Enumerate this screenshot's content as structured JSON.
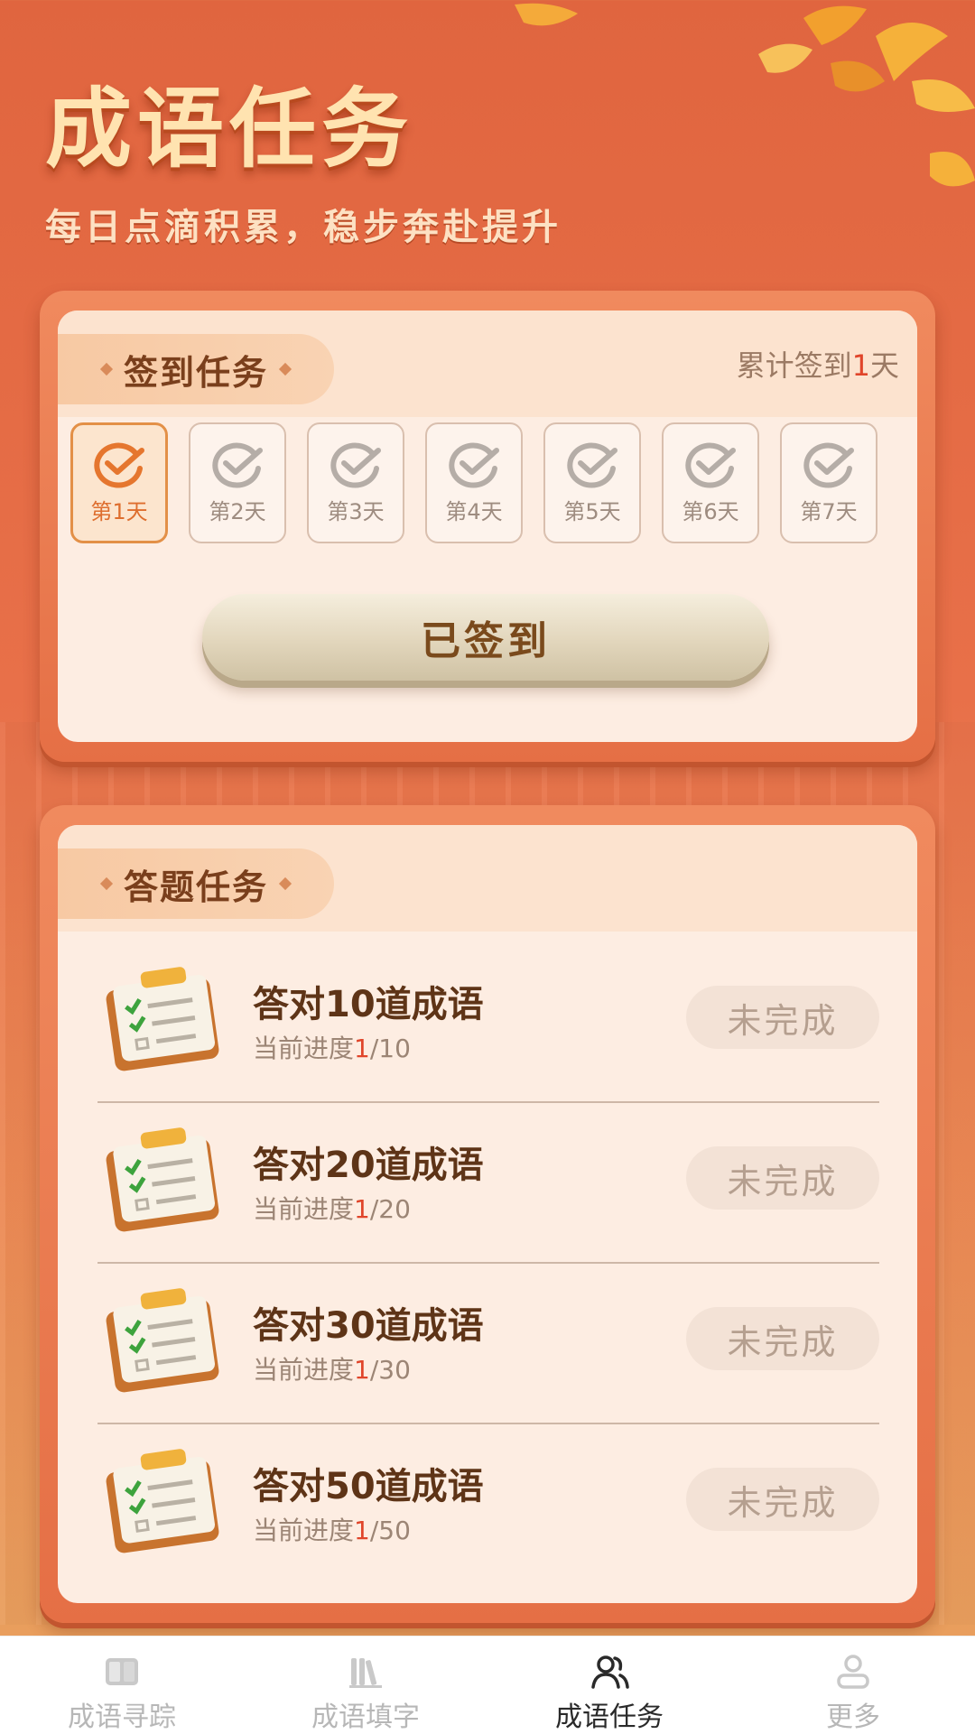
{
  "header": {
    "title": "成语任务",
    "subtitle": "每日点滴积累，稳步奔赴提升"
  },
  "signin": {
    "title": "签到任务",
    "total_prefix": "累计签到",
    "total_days": "1",
    "total_suffix": "天",
    "days": [
      {
        "label": "第1天",
        "checked": true
      },
      {
        "label": "第2天",
        "checked": false
      },
      {
        "label": "第3天",
        "checked": false
      },
      {
        "label": "第4天",
        "checked": false
      },
      {
        "label": "第5天",
        "checked": false
      },
      {
        "label": "第6天",
        "checked": false
      },
      {
        "label": "第7天",
        "checked": false
      }
    ],
    "button_label": "已签到"
  },
  "quiz": {
    "title": "答题任务",
    "progress_prefix": "当前进度",
    "tasks": [
      {
        "title": "答对10道成语",
        "current": "1",
        "total": "/10",
        "status": "未完成"
      },
      {
        "title": "答对20道成语",
        "current": "1",
        "total": "/20",
        "status": "未完成"
      },
      {
        "title": "答对30道成语",
        "current": "1",
        "total": "/30",
        "status": "未完成"
      },
      {
        "title": "答对50道成语",
        "current": "1",
        "total": "/50",
        "status": "未完成"
      }
    ]
  },
  "tabbar": {
    "tabs": [
      {
        "label": "成语寻踪",
        "icon": "book-icon",
        "active": false
      },
      {
        "label": "成语填字",
        "icon": "library-icon",
        "active": false
      },
      {
        "label": "成语任务",
        "icon": "users-icon",
        "active": true
      },
      {
        "label": "更多",
        "icon": "profile-icon",
        "active": false
      }
    ]
  },
  "colors": {
    "background": "#E0653F",
    "accent": "#E0452A",
    "active_day": "#E39047"
  }
}
